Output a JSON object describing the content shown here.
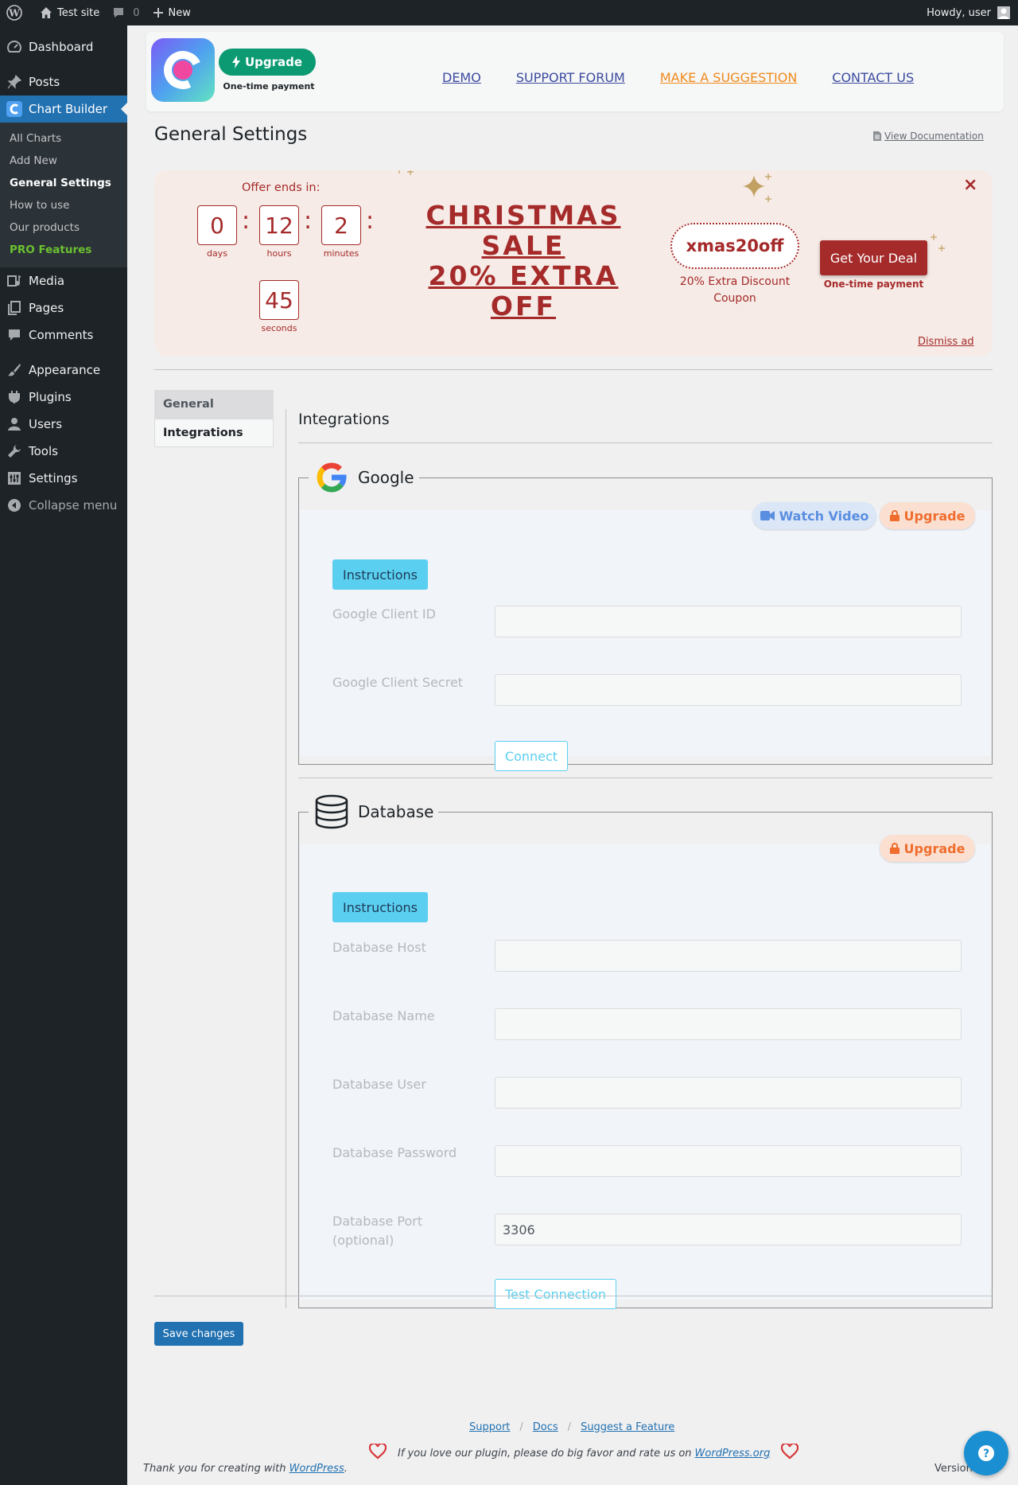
{
  "adminbar": {
    "site_name": "Test site",
    "comments_count": "0",
    "new_label": "New",
    "howdy": "Howdy, user"
  },
  "sidebar": {
    "items": [
      {
        "label": "Dashboard",
        "icon": "dashboard-icon"
      },
      {
        "label": "Posts",
        "icon": "pin-icon"
      },
      {
        "label": "Chart Builder",
        "icon": "chart-builder-icon"
      },
      {
        "label": "Media",
        "icon": "media-icon"
      },
      {
        "label": "Pages",
        "icon": "pages-icon"
      },
      {
        "label": "Comments",
        "icon": "comment-icon"
      },
      {
        "label": "Appearance",
        "icon": "brush-icon"
      },
      {
        "label": "Plugins",
        "icon": "plugin-icon"
      },
      {
        "label": "Users",
        "icon": "user-icon"
      },
      {
        "label": "Tools",
        "icon": "wrench-icon"
      },
      {
        "label": "Settings",
        "icon": "settings-icon"
      },
      {
        "label": "Collapse menu",
        "icon": "collapse-icon"
      }
    ],
    "submenu": [
      "All Charts",
      "Add New",
      "General Settings",
      "How to use",
      "Our products",
      "PRO Features"
    ]
  },
  "plugin_header": {
    "upgrade_label": "Upgrade",
    "one_time": "One-time payment",
    "links": [
      "DEMO",
      "SUPPORT FORUM",
      "MAKE A SUGGESTION",
      "CONTACT US"
    ]
  },
  "page": {
    "title": "General Settings",
    "view_doc": "View Documentation"
  },
  "promo": {
    "offer_label": "Offer ends in:",
    "days": "0",
    "days_label": "days",
    "hours": "12",
    "hours_label": "hours",
    "minutes": "2",
    "minutes_label": "minutes",
    "seconds": "45",
    "seconds_label": "seconds",
    "title_line1": "CHRISTMAS",
    "title_line2": "SALE",
    "title_line3": "20% EXTRA",
    "title_line4": "OFF",
    "coupon_code": "xmas20off",
    "coupon_sub": "20% Extra Discount Coupon",
    "deal_label": "Get Your Deal",
    "deal_sub": "One-time payment",
    "close": "×",
    "dismiss": "Dismiss ad"
  },
  "tabs": [
    "General",
    "Integrations"
  ],
  "integrations": {
    "heading": "Integrations",
    "google": {
      "legend": "Google",
      "watch_video": "Watch Video",
      "upgrade": "Upgrade",
      "instructions": "Instructions",
      "client_id_label": "Google Client ID",
      "client_id_value": "",
      "client_secret_label": "Google Client Secret",
      "client_secret_value": "",
      "connect": "Connect"
    },
    "database": {
      "legend": "Database",
      "upgrade": "Upgrade",
      "instructions": "Instructions",
      "host_label": "Database Host",
      "host_value": "",
      "name_label": "Database Name",
      "name_value": "",
      "user_label": "Database User",
      "user_value": "",
      "password_label": "Database Password",
      "password_value": "",
      "port_label_1": "Database Port",
      "port_label_2": "(optional)",
      "port_value": "3306",
      "test_connection": "Test Connection"
    }
  },
  "save_label": "Save changes",
  "footer": {
    "support": "Support",
    "docs": "Docs",
    "suggest": "Suggest a Feature",
    "love_text": "If you love our plugin, please do big favor and rate us on",
    "wp_org": "WordPress.org",
    "thanks_text": "Thank you for creating with",
    "wordpress": "WordPress",
    "version": "Version"
  },
  "colors": {
    "accent": "#2271b1",
    "promo_red": "#a52a2a",
    "upgrade_green": "#0c9a72",
    "instructions_cyan": "#5bcff0"
  }
}
